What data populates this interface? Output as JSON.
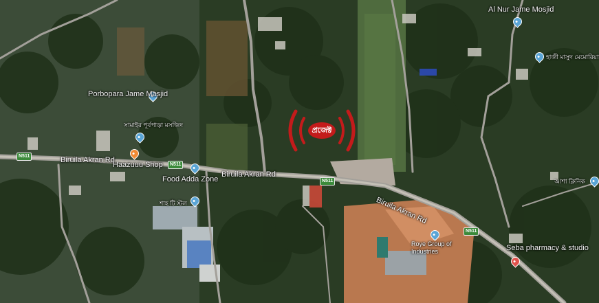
{
  "map": {
    "project_marker": {
      "label": "প্রজেক্ট",
      "color": "#c41b1b"
    },
    "roads": [
      {
        "id": "biruila-west",
        "name": "Biruila Akran Rd"
      },
      {
        "id": "biruila-mid",
        "name": "Biruila Akran Rd"
      },
      {
        "id": "biruila-east",
        "name": "Biruila Akran Rd"
      }
    ],
    "route_shields": [
      {
        "id": "n511-a",
        "label": "N511"
      },
      {
        "id": "n511-b",
        "label": "N511"
      },
      {
        "id": "n511-c",
        "label": "N511"
      },
      {
        "id": "n511-d",
        "label": "N511"
      }
    ],
    "places": [
      {
        "id": "al-nur",
        "name": "Al Nur Jame Mosjid",
        "icon": "mosque-pin",
        "color": "#5aa5d6"
      },
      {
        "id": "porbopara",
        "name": "Porbopara Jame Masjid",
        "icon": "mosque-pin",
        "color": "#5aa5d6"
      },
      {
        "id": "hazuuu",
        "name": "Haazuuu Shop",
        "icon": "shop-pin",
        "color": "#f08a34"
      },
      {
        "id": "food-adda",
        "name": "Food Adda Zone",
        "icon": "food-pin",
        "color": "#5aa5d6"
      },
      {
        "id": "roye",
        "name": "Roye Group of Industries",
        "icon": "industry-pin",
        "color": "#5aa5d6"
      },
      {
        "id": "seba",
        "name": "Seba pharmacy & studio",
        "icon": "pharmacy-pin",
        "color": "#e0534d"
      }
    ],
    "bangla_labels": [
      {
        "id": "bn-1",
        "text": "সামাইর পূর্বপাড়া মসজিদ"
      },
      {
        "id": "bn-2",
        "text": "শাহ টি স্টল"
      },
      {
        "id": "bn-3",
        "text": "হাজী মাসুদ মেমোরিয়াল"
      },
      {
        "id": "bn-4",
        "text": "আশা ক্লিনিক"
      }
    ]
  }
}
